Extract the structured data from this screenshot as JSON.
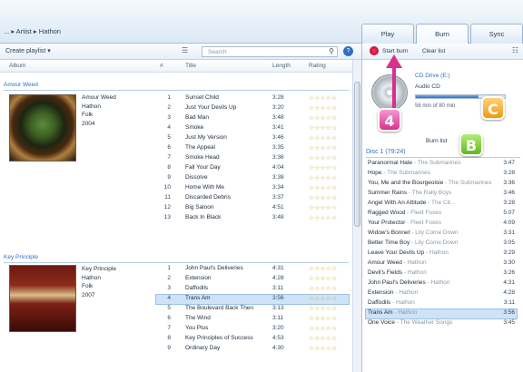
{
  "nav": {
    "breadcrumb": "... ▸ Artist ▸ Hathon",
    "tabs": [
      {
        "label": "Play",
        "active": false
      },
      {
        "label": "Burn",
        "active": true
      },
      {
        "label": "Sync",
        "active": false
      }
    ]
  },
  "library_toolbar": {
    "create_playlist": "Create playlist ▾",
    "search_placeholder": "Search",
    "view_icon": "view-options-icon",
    "search_icon": "search-icon",
    "help_icon": "help-icon"
  },
  "columns": [
    "Album",
    "#",
    "Title",
    "Length",
    "Rating"
  ],
  "albums": [
    {
      "group_header": "Amour Weed",
      "cover_icon": "album-art-amour-weed",
      "info": [
        "Amour Weed",
        "Hathon",
        "Folk",
        "2004"
      ],
      "tracks": [
        {
          "num": "1",
          "title": "Sunset Child",
          "length": "3:28",
          "rating": "☆☆☆☆☆"
        },
        {
          "num": "2",
          "title": "Just Your Devils Up",
          "length": "3:20",
          "rating": "☆☆☆☆☆"
        },
        {
          "num": "3",
          "title": "Bad Man",
          "length": "3:48",
          "rating": "☆☆☆☆☆"
        },
        {
          "num": "4",
          "title": "Smoke",
          "length": "3:41",
          "rating": "☆☆☆☆☆"
        },
        {
          "num": "5",
          "title": "Just My Version",
          "length": "3:46",
          "rating": "☆☆☆☆☆"
        },
        {
          "num": "6",
          "title": "The Appeal",
          "length": "3:35",
          "rating": "☆☆☆☆☆"
        },
        {
          "num": "7",
          "title": "Smoke Head",
          "length": "3:36",
          "rating": "☆☆☆☆☆"
        },
        {
          "num": "8",
          "title": "Fall Your Day",
          "length": "4:04",
          "rating": "☆☆☆☆☆"
        },
        {
          "num": "9",
          "title": "Dissolve",
          "length": "3:38",
          "rating": "☆☆☆☆☆"
        },
        {
          "num": "10",
          "title": "Home With Me",
          "length": "3:34",
          "rating": "☆☆☆☆☆"
        },
        {
          "num": "11",
          "title": "Discarded Debris",
          "length": "3:37",
          "rating": "☆☆☆☆☆"
        },
        {
          "num": "12",
          "title": "Big Saloon",
          "length": "4:51",
          "rating": "☆☆☆☆☆"
        },
        {
          "num": "13",
          "title": "Back In Black",
          "length": "3:48",
          "rating": "☆☆☆☆☆"
        }
      ]
    },
    {
      "group_header": "Key Principle",
      "cover_icon": "album-art-key-principle",
      "info": [
        "Key Principle",
        "Hathon",
        "Folk",
        "2007"
      ],
      "tracks": [
        {
          "num": "1",
          "title": "John Paul's Deliveries",
          "length": "4:31",
          "rating": "☆☆☆☆☆",
          "selected": false
        },
        {
          "num": "2",
          "title": "Extension",
          "length": "4:28",
          "rating": "☆☆☆☆☆",
          "selected": false
        },
        {
          "num": "3",
          "title": "Daffodils",
          "length": "3:11",
          "rating": "☆☆☆☆☆",
          "selected": false
        },
        {
          "num": "4",
          "title": "Trans Am",
          "length": "3:56",
          "rating": "☆☆☆☆☆",
          "selected": true
        },
        {
          "num": "5",
          "title": "The Boulevard Back Then",
          "length": "3:13",
          "rating": "☆☆☆☆☆",
          "selected": false
        },
        {
          "num": "6",
          "title": "The Wind",
          "length": "3:11",
          "rating": "☆☆☆☆☆",
          "selected": false
        },
        {
          "num": "7",
          "title": "You Plus",
          "length": "3:20",
          "rating": "☆☆☆☆☆",
          "selected": false
        },
        {
          "num": "8",
          "title": "Key Principles of Success",
          "length": "4:53",
          "rating": "☆☆☆☆☆",
          "selected": false
        },
        {
          "num": "9",
          "title": "Ordinary Day",
          "length": "4:30",
          "rating": "☆☆☆☆☆",
          "selected": false
        }
      ]
    }
  ],
  "burn_pane": {
    "start_burn": "Start burn",
    "clear_list": "Clear list",
    "disc_drive": "CD Drive (E:)",
    "disc_type": "Audio CD",
    "capacity_text": "56 min of 80 min",
    "capacity_fraction": 0.7,
    "burn_list_label": "Burn list",
    "disc_header": "Disc 1 (79:24)",
    "tracks": [
      {
        "title": "Paranormal Hate",
        "artist": "The Submarines",
        "length": "3:47",
        "selected": false
      },
      {
        "title": "Hope",
        "artist": "The Submarines",
        "length": "3:28",
        "selected": false
      },
      {
        "title": "You, Me and the Bourgeoisie",
        "artist": "The Submarines",
        "length": "3:36",
        "selected": false
      },
      {
        "title": "Summer Rains",
        "artist": "The Rally Boys",
        "length": "3:46",
        "selected": false
      },
      {
        "title": "Angel With An Attitude",
        "artist": "The Cit...",
        "length": "3:28",
        "selected": false
      },
      {
        "title": "Ragged Wood",
        "artist": "Fleet Foxes",
        "length": "5:07",
        "selected": false
      },
      {
        "title": "Your Protector",
        "artist": "Fleet Foxes",
        "length": "4:09",
        "selected": false
      },
      {
        "title": "Widow's Bonnet",
        "artist": "Lily Come Down",
        "length": "3:31",
        "selected": false
      },
      {
        "title": "Better Time Boy",
        "artist": "Lily Come Down",
        "length": "3:05",
        "selected": false
      },
      {
        "title": "Leave Your Devils Up",
        "artist": "Hathon",
        "length": "3:29",
        "selected": false
      },
      {
        "title": "Amour Weed",
        "artist": "Hathon",
        "length": "3:30",
        "selected": false
      },
      {
        "title": "Devil's Fields",
        "artist": "Hathon",
        "length": "3:26",
        "selected": false
      },
      {
        "title": "John Paul's Deliveries",
        "artist": "Hathon",
        "length": "4:31",
        "selected": false
      },
      {
        "title": "Extension",
        "artist": "Hathon",
        "length": "4:28",
        "selected": false
      },
      {
        "title": "Daffodils",
        "artist": "Hathon",
        "length": "3:11",
        "selected": false
      },
      {
        "title": "Trans Am",
        "artist": "Hathon",
        "length": "3:56",
        "selected": true
      },
      {
        "title": "One Voice",
        "artist": "The Weather Songs",
        "length": "3:45",
        "selected": false
      }
    ]
  },
  "callouts": [
    "4",
    "C",
    "B"
  ],
  "colors": {
    "accent": "#2f6fc0",
    "callout_4": "#d9308e",
    "callout_c": "#f09a12",
    "callout_b": "#5fb81e"
  }
}
